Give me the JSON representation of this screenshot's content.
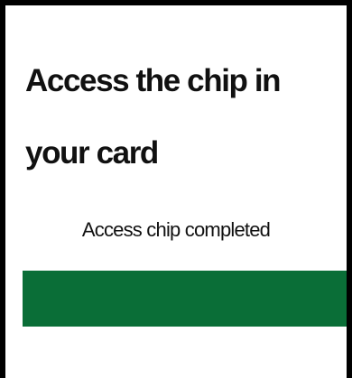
{
  "screen": {
    "title": "Access the chip in your card",
    "status_text": "Access chip completed"
  },
  "progress": {
    "value_fraction": 1.0,
    "fill_color": "#0a6e37"
  }
}
